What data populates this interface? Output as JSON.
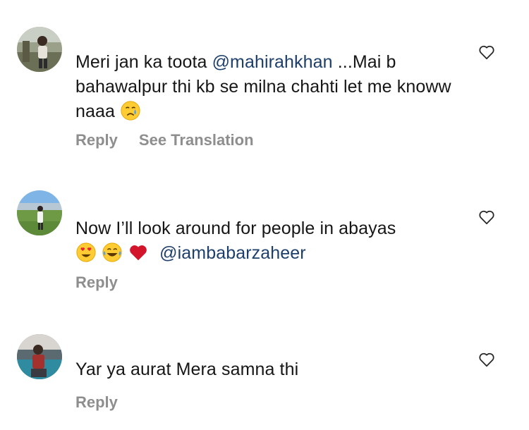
{
  "comments": [
    {
      "text_before": "Meri jan ka toota ",
      "mention": "@mahirahkhan",
      "text_after": " ...Mai b bahawalpur thi kb se milna chahti let me knoww naaa ",
      "reply_label": "Reply",
      "translate_label": "See Translation",
      "emojis": [
        "crying-face"
      ]
    },
    {
      "text_before": "Now I’ll look around for people in abayas",
      "mention": "@iambabarzaheer",
      "reply_label": "Reply",
      "emojis": [
        "heart-eyes-face",
        "tears-of-joy-face",
        "red-heart"
      ]
    },
    {
      "text_before": "Yar ya aurat Mera samna thi",
      "reply_label": "Reply"
    }
  ],
  "colors": {
    "mention": "#1d3f6b",
    "muted": "#8e8e8e"
  },
  "icons": [
    "heart-outline-icon",
    "avatar"
  ]
}
